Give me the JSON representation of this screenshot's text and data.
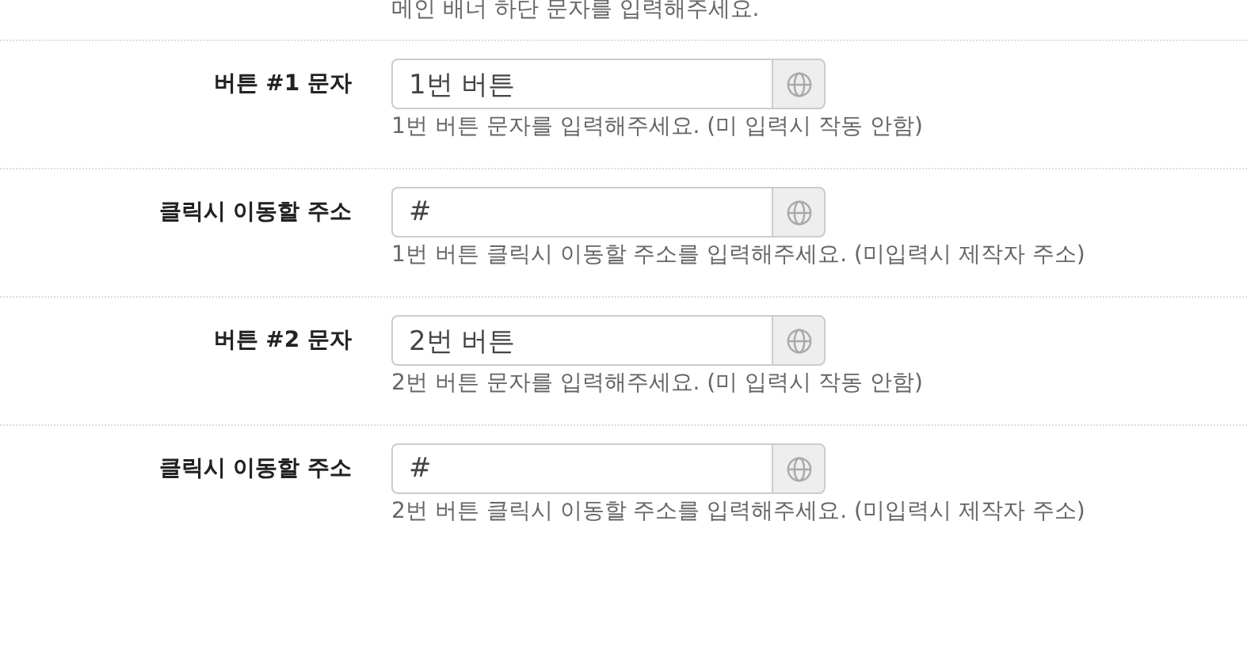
{
  "top_help": "메인 배너 하단 문자를 입력해주세요.",
  "rows": [
    {
      "label": "버튼 #1 문자",
      "value": "1번 버튼",
      "help": "1번 버튼 문자를 입력해주세요. (미 입력시 작동 안함)"
    },
    {
      "label": "클릭시 이동할 주소",
      "value": "#",
      "help": "1번 버튼 클릭시 이동할 주소를 입력해주세요. (미입력시 제작자 주소)"
    },
    {
      "label": "버튼 #2 문자",
      "value": "2번 버튼",
      "help": "2번 버튼 문자를 입력해주세요. (미 입력시 작동 안함)"
    },
    {
      "label": "클릭시 이동할 주소",
      "value": "#",
      "help": "2번 버튼 클릭시 이동할 주소를 입력해주세요. (미입력시 제작자 주소)"
    }
  ]
}
